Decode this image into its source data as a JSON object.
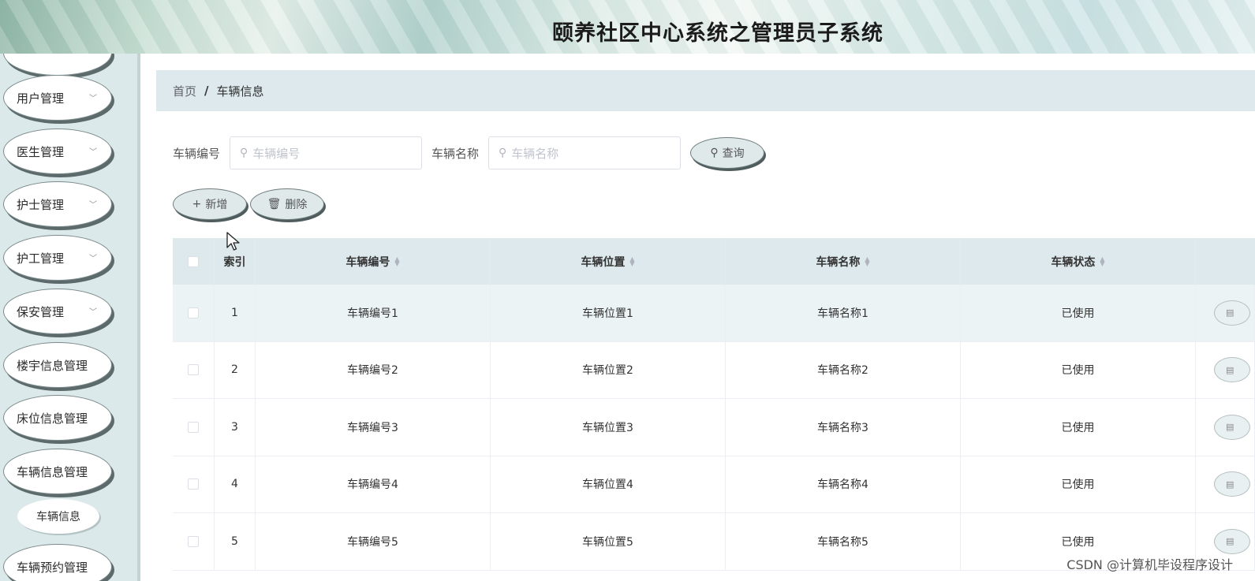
{
  "header": {
    "title": "颐养社区中心系统之管理员子系统"
  },
  "sidebar": {
    "items": [
      {
        "label": "用户管理",
        "has_chevron": true
      },
      {
        "label": "医生管理",
        "has_chevron": true
      },
      {
        "label": "护士管理",
        "has_chevron": true
      },
      {
        "label": "护工管理",
        "has_chevron": true
      },
      {
        "label": "保安管理",
        "has_chevron": true
      },
      {
        "label": "楼宇信息管理",
        "has_chevron": false
      },
      {
        "label": "床位信息管理",
        "has_chevron": false
      },
      {
        "label": "车辆信息管理",
        "has_chevron": false
      },
      {
        "label": "车辆预约管理",
        "has_chevron": false
      }
    ],
    "submenu": {
      "label": "车辆信息"
    }
  },
  "breadcrumb": {
    "home": "首页",
    "separator": "/",
    "current": "车辆信息"
  },
  "search": {
    "field1_label": "车辆编号",
    "field1_placeholder": "车辆编号",
    "field2_label": "车辆名称",
    "field2_placeholder": "车辆名称",
    "query_label": "查询"
  },
  "actions": {
    "add_label": "新增",
    "delete_label": "删除"
  },
  "table": {
    "columns": [
      "索引",
      "车辆编号",
      "车辆位置",
      "车辆名称",
      "车辆状态"
    ],
    "rows": [
      {
        "index": "1",
        "code": "车辆编号1",
        "location": "车辆位置1",
        "name": "车辆名称1",
        "status": "已使用"
      },
      {
        "index": "2",
        "code": "车辆编号2",
        "location": "车辆位置2",
        "name": "车辆名称2",
        "status": "已使用"
      },
      {
        "index": "3",
        "code": "车辆编号3",
        "location": "车辆位置3",
        "name": "车辆名称3",
        "status": "已使用"
      },
      {
        "index": "4",
        "code": "车辆编号4",
        "location": "车辆位置4",
        "name": "车辆名称4",
        "status": "已使用"
      },
      {
        "index": "5",
        "code": "车辆编号5",
        "location": "车辆位置5",
        "name": "车辆名称5",
        "status": "已使用"
      }
    ]
  },
  "watermark": "CSDN @计算机毕设程序设计",
  "icons": {
    "search": "search-icon",
    "add": "plus-icon",
    "delete": "trash-icon",
    "chevron": "chevron-down-icon",
    "detail": "document-icon",
    "cursor": "mouse-cursor-icon"
  },
  "colors": {
    "sidebar_bg": "#dce9ea",
    "breadcrumb_bg": "#dde9ec",
    "table_header_bg": "#dde9ec",
    "highlight_row_bg": "#ecf3f4"
  }
}
